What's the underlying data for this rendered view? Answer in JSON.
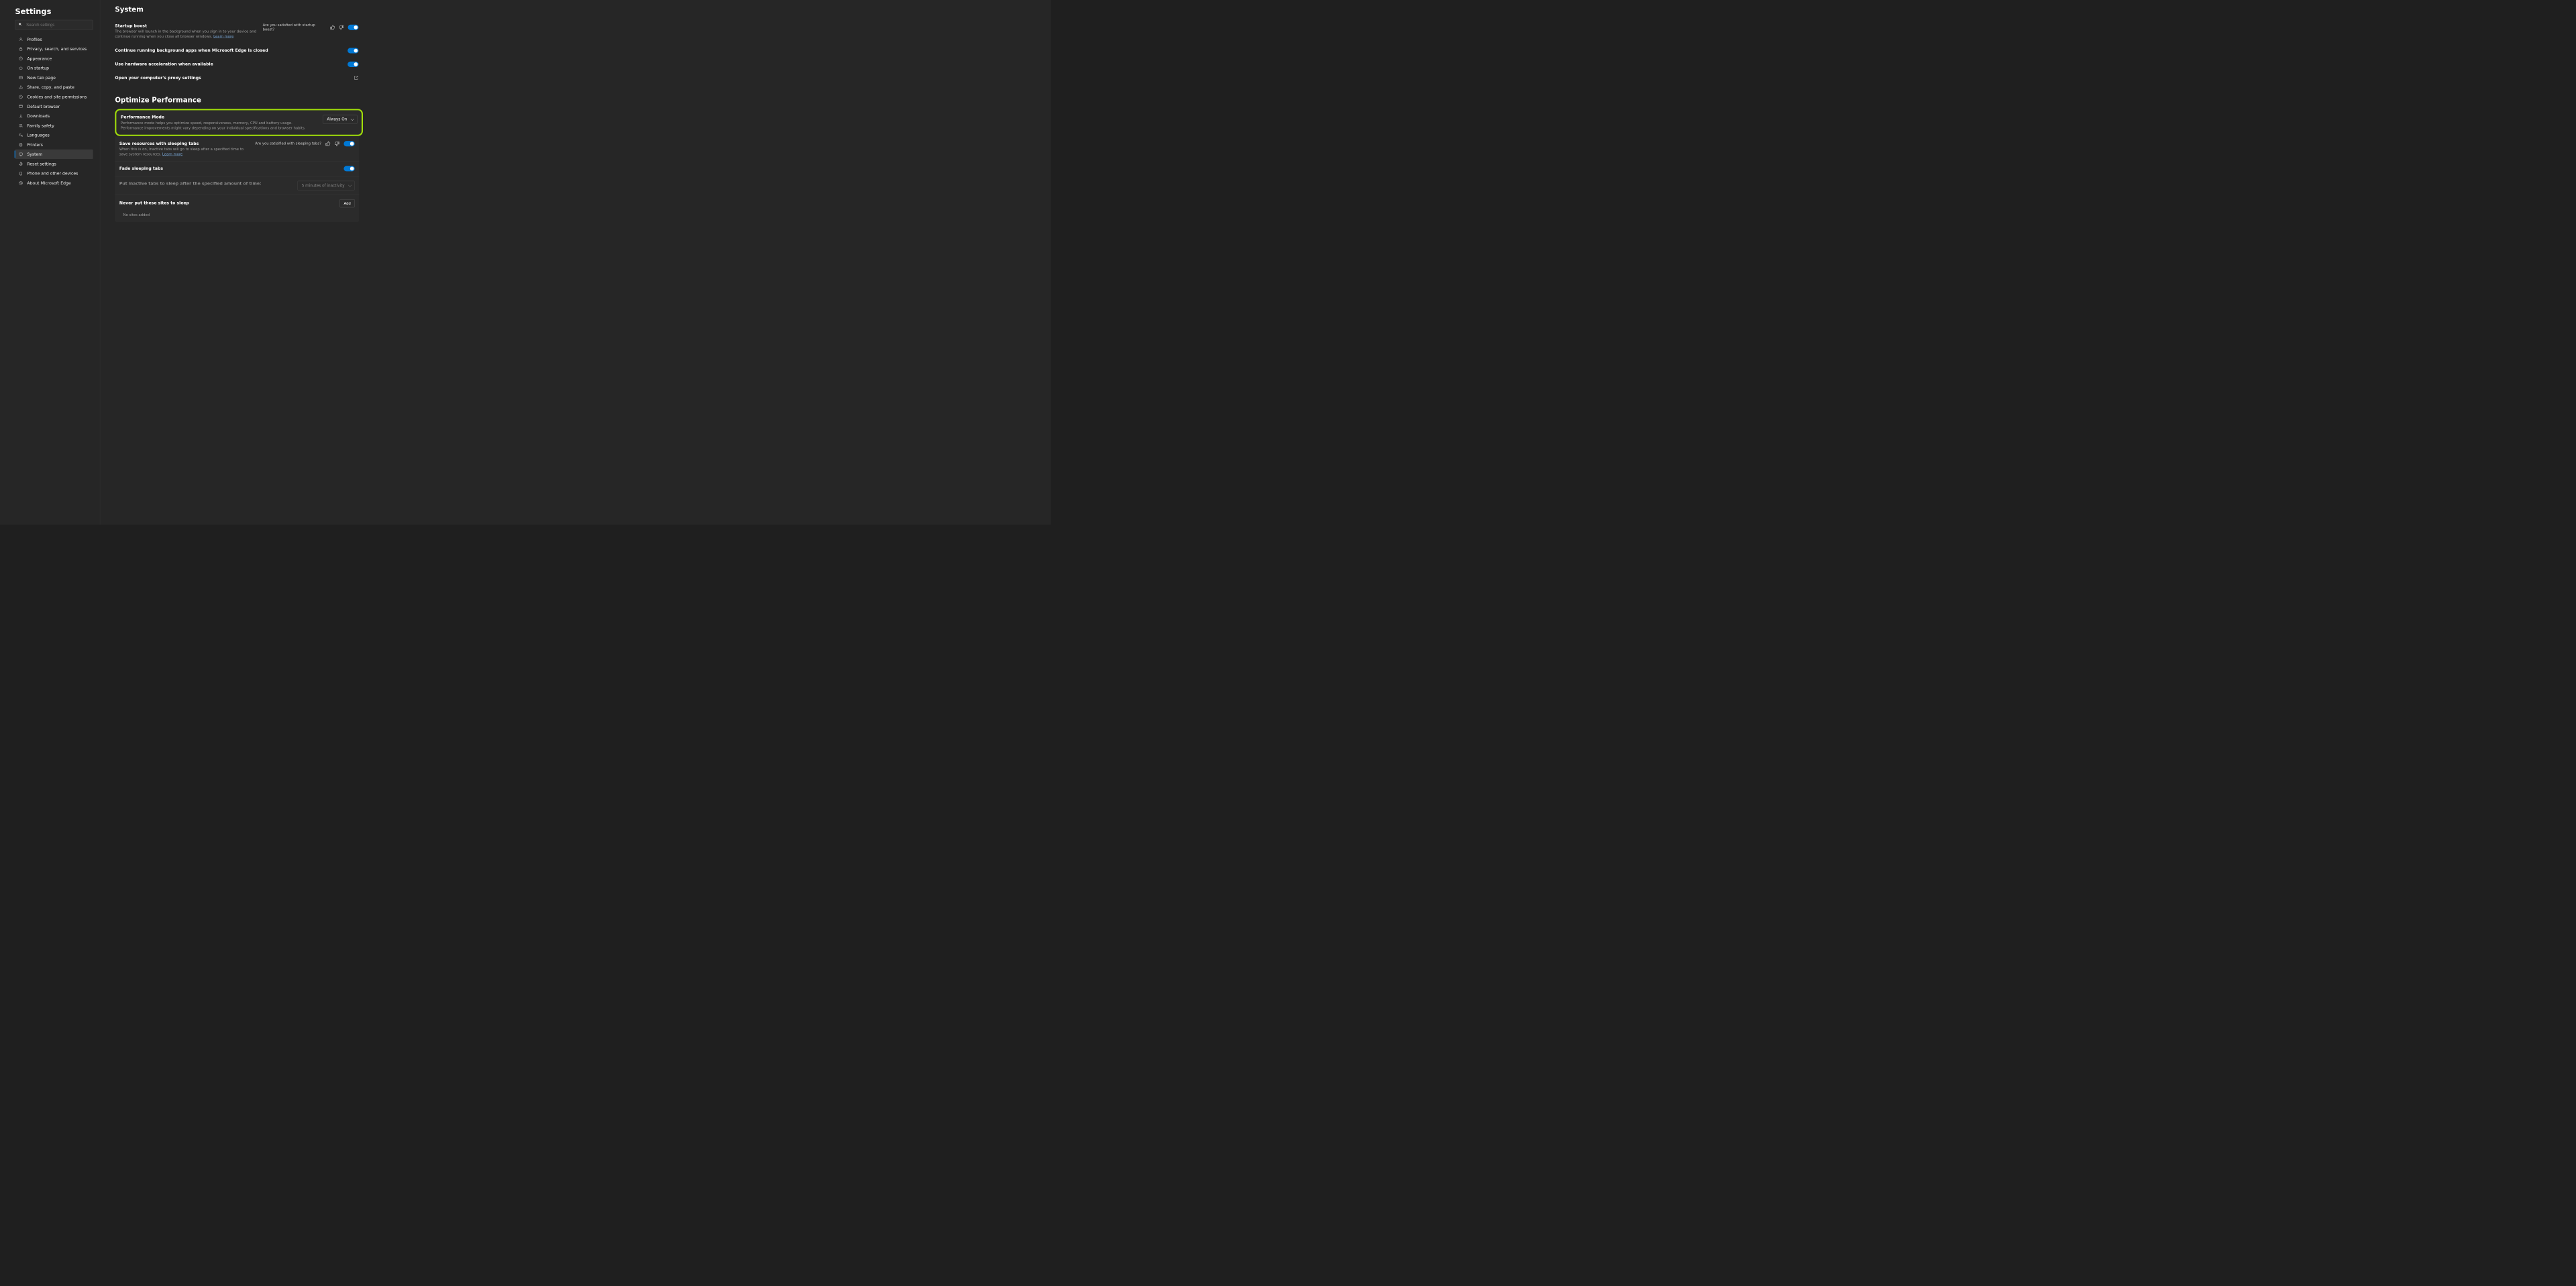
{
  "sidebar_title": "Settings",
  "search_placeholder": "Search settings",
  "nav": [
    {
      "icon": "profile",
      "label": "Profiles"
    },
    {
      "icon": "lock",
      "label": "Privacy, search, and services"
    },
    {
      "icon": "palette",
      "label": "Appearance"
    },
    {
      "icon": "power",
      "label": "On startup"
    },
    {
      "icon": "tab",
      "label": "New tab page"
    },
    {
      "icon": "share",
      "label": "Share, copy, and paste"
    },
    {
      "icon": "cookie",
      "label": "Cookies and site permissions"
    },
    {
      "icon": "browser",
      "label": "Default browser"
    },
    {
      "icon": "download",
      "label": "Downloads"
    },
    {
      "icon": "family",
      "label": "Family safety"
    },
    {
      "icon": "lang",
      "label": "Languages"
    },
    {
      "icon": "printer",
      "label": "Printers"
    },
    {
      "icon": "system",
      "label": "System"
    },
    {
      "icon": "reset",
      "label": "Reset settings"
    },
    {
      "icon": "phone",
      "label": "Phone and other devices"
    },
    {
      "icon": "edge",
      "label": "About Microsoft Edge"
    }
  ],
  "active_nav": "System",
  "system": {
    "title": "System",
    "startup_boost": {
      "title": "Startup boost",
      "desc": "The browser will launch in the background when you sign in to your device and continue running when you close all browser windows.",
      "learn_more": "Learn more",
      "question": "Are you satisfied with startup boost?"
    },
    "bg_apps": "Continue running background apps when Microsoft Edge is closed",
    "hw_accel": "Use hardware acceleration when available",
    "proxy": "Open your computer's proxy settings"
  },
  "optimize": {
    "title": "Optimize Performance",
    "perf_mode": {
      "title": "Performance Mode",
      "desc": "Performance mode helps you optimize speed, responsiveness, memory, CPU and battery usage. Performance improvements might vary depending on your individual specifications and browser habits.",
      "value": "Always On"
    },
    "sleeping": {
      "title": "Save resources with sleeping tabs",
      "desc": "When this is on, inactive tabs will go to sleep after a specified time to save system resources.",
      "learn_more": "Learn more",
      "question": "Are you satisified with sleeping tabs?"
    },
    "fade": "Fade sleeping tabs",
    "inactive": {
      "label": "Put inactive tabs to sleep after the specified amount of time:",
      "value": "5 minutes of inactivity"
    },
    "never_sleep": {
      "label": "Never put these sites to sleep",
      "add": "Add",
      "empty": "No sites added"
    }
  }
}
